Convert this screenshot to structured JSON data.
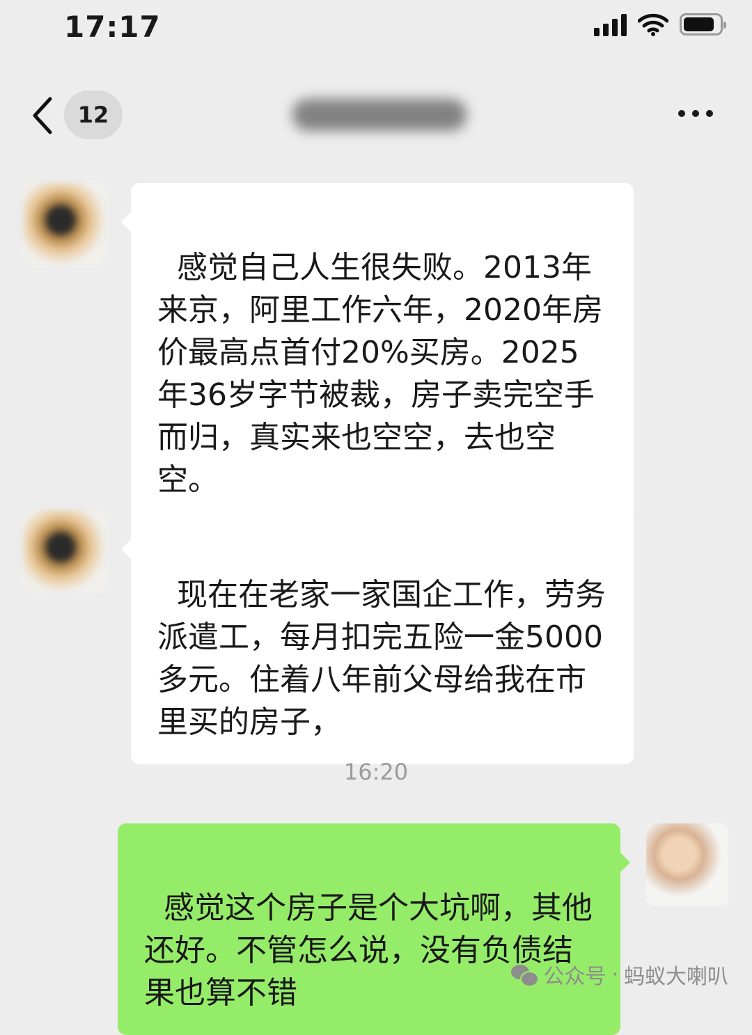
{
  "status_bar": {
    "time": "17:17",
    "icons": [
      "signal-icon",
      "wifi-icon",
      "battery-icon"
    ],
    "battery_level": 0.85
  },
  "nav": {
    "back_icon": "chevron-left-icon",
    "unread_count": "12",
    "more_icon": "more-icon"
  },
  "messages": [
    {
      "sender": "contact",
      "text": "感觉自己人生很失败。2013年来京，阿里工作六年，2020年房价最高点首付20%买房。2025年36岁字节被裁，房子卖完空手而归，真实来也空空，去也空空。"
    },
    {
      "sender": "contact",
      "text": "现在在老家一家国企工作，劳务派遣工，每月扣完五险一金5000多元。住着八年前父母给我在市里买的房子，"
    },
    {
      "sender": "me",
      "text": "感觉这个房子是个大坑啊，其他还好。不管怎么说，没有负债结果也算不错"
    }
  ],
  "timestamp": "16:20",
  "watermark": {
    "icon": "wechat-icon",
    "label": "公众号",
    "separator": "·",
    "account": "蚂蚁大喇叭"
  },
  "colors": {
    "background": "#ededed",
    "incoming_bubble": "#ffffff",
    "outgoing_bubble": "#95ec69",
    "text": "#191919",
    "timestamp": "#9b9b9b"
  }
}
